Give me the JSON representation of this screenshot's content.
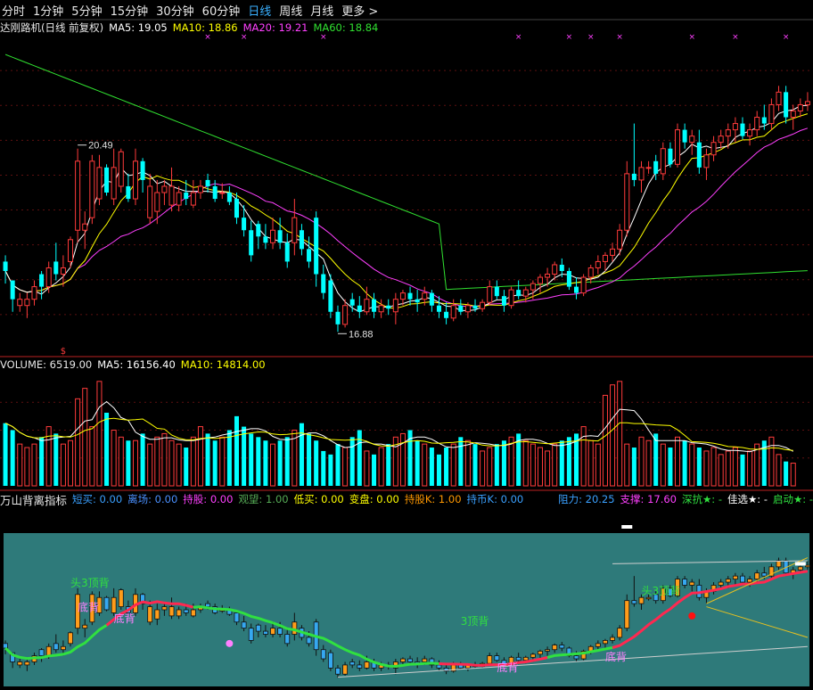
{
  "tabs": {
    "items": [
      "分时",
      "1分钟",
      "5分钟",
      "15分钟",
      "30分钟",
      "60分钟",
      "日线",
      "周线",
      "月线",
      "更多 >"
    ],
    "active_index": 6
  },
  "main_panel": {
    "title": "达刚路机(日线 前复权)",
    "ma5": "MA5: 19.05",
    "ma10": "MA10: 18.86",
    "ma20": "MA20: 19.21",
    "ma60": "MA60: 18.84",
    "high_label": "20.49",
    "low_label": "16.88",
    "signal_mark": "$"
  },
  "volume_panel": {
    "volume": "VOLUME: 6519.00",
    "ma5": "MA5: 16156.40",
    "ma10": "MA10: 14814.00"
  },
  "indicator_panel": {
    "name": "万山背离指标",
    "items": [
      {
        "label": "短买:",
        "value": "0.00",
        "color": "#3aa0ff"
      },
      {
        "label": "离场:",
        "value": "0.00",
        "color": "#4a90ff"
      },
      {
        "label": "持股:",
        "value": "0.00",
        "color": "#ff40ff"
      },
      {
        "label": "观望:",
        "value": "1.00",
        "color": "#55aa55"
      },
      {
        "label": "低买:",
        "value": "0.00",
        "color": "#ffff00"
      },
      {
        "label": "变盘:",
        "value": "0.00",
        "color": "#ffff00"
      },
      {
        "label": "持股K:",
        "value": "1.00",
        "color": "#ff9800"
      },
      {
        "label": "持币K:",
        "value": "0.00",
        "color": "#3aa0ff"
      }
    ],
    "resist": "阻力: 20.25",
    "support": "支撑: 17.60",
    "deep": "深抗★: -",
    "best": "佳选★: -",
    "start": "启动★: -",
    "annotations": [
      {
        "text": "头3顶背",
        "color": "#30e040"
      },
      {
        "text": "底背",
        "color": "#ff80ff"
      },
      {
        "text": "底背",
        "color": "#ff80ff"
      },
      {
        "text": "3顶背",
        "color": "#30e040"
      },
      {
        "text": "头3顶背",
        "color": "#30e040"
      },
      {
        "text": "底背",
        "color": "#ff80ff"
      },
      {
        "text": "底背",
        "color": "#ff80ff"
      }
    ]
  },
  "colors": {
    "up": "#ff3b3b",
    "down": "#00ffff",
    "ma5": "#ffffff",
    "ma10": "#ffff00",
    "ma20": "#ff40ff",
    "ma60": "#30e030",
    "grid_red": "#9b1c1c",
    "indicator_bg": "#2e7a7a"
  },
  "chart_data": {
    "type": "candlestick",
    "price_series": {
      "name": "达刚路机",
      "ylim": [
        16.6,
        21.6
      ],
      "ohlc": [
        [
          18.0,
          18.1,
          17.65,
          17.85
        ],
        [
          17.7,
          17.7,
          17.2,
          17.4
        ],
        [
          17.3,
          17.5,
          17.2,
          17.4
        ],
        [
          17.3,
          17.5,
          17.1,
          17.4
        ],
        [
          17.4,
          17.7,
          17.3,
          17.6
        ],
        [
          17.8,
          17.85,
          17.4,
          17.6
        ],
        [
          17.6,
          18.0,
          17.5,
          17.9
        ],
        [
          18.0,
          18.3,
          17.7,
          17.8
        ],
        [
          17.8,
          18.1,
          17.6,
          17.9
        ],
        [
          18.0,
          18.4,
          17.9,
          18.35
        ],
        [
          18.5,
          19.8,
          18.3,
          19.6
        ],
        [
          18.5,
          18.8,
          18.2,
          18.6
        ],
        [
          18.7,
          19.7,
          18.6,
          19.6
        ],
        [
          19.0,
          19.7,
          18.9,
          19.5
        ],
        [
          19.5,
          19.55,
          19.05,
          19.1
        ],
        [
          19.0,
          19.8,
          18.9,
          19.5
        ],
        [
          19.2,
          19.8,
          19.1,
          19.75
        ],
        [
          19.2,
          19.4,
          18.95,
          19.0
        ],
        [
          19.0,
          19.8,
          18.9,
          19.6
        ],
        [
          19.6,
          19.65,
          19.1,
          19.3
        ],
        [
          18.7,
          19.4,
          18.6,
          19.2
        ],
        [
          18.8,
          19.3,
          18.6,
          19.1
        ],
        [
          19.1,
          19.3,
          18.9,
          19.2
        ],
        [
          18.9,
          19.5,
          18.8,
          19.2
        ],
        [
          18.9,
          19.2,
          18.8,
          19.1
        ],
        [
          19.1,
          19.3,
          18.9,
          19.0
        ],
        [
          18.9,
          19.3,
          18.85,
          19.1
        ],
        [
          19.1,
          19.3,
          19.0,
          19.2
        ],
        [
          19.3,
          19.4,
          19.1,
          19.2
        ],
        [
          19.2,
          19.3,
          18.95,
          19.0
        ],
        [
          19.1,
          19.25,
          19.0,
          19.1
        ],
        [
          19.1,
          19.2,
          18.9,
          18.95
        ],
        [
          19.0,
          19.1,
          18.6,
          18.7
        ],
        [
          18.7,
          18.9,
          18.4,
          18.5
        ],
        [
          18.5,
          18.65,
          18.0,
          18.1
        ],
        [
          18.6,
          18.65,
          18.2,
          18.4
        ],
        [
          18.4,
          18.6,
          18.2,
          18.3
        ],
        [
          18.3,
          18.7,
          18.2,
          18.5
        ],
        [
          18.5,
          18.7,
          18.2,
          18.3
        ],
        [
          18.3,
          18.45,
          17.9,
          18.0
        ],
        [
          18.3,
          19.0,
          18.1,
          18.7
        ],
        [
          18.5,
          18.6,
          18.1,
          18.2
        ],
        [
          18.2,
          18.4,
          17.9,
          18.0
        ],
        [
          18.7,
          18.8,
          17.6,
          17.8
        ],
        [
          17.8,
          17.95,
          17.4,
          17.5
        ],
        [
          17.7,
          17.8,
          17.1,
          17.2
        ],
        [
          17.2,
          17.3,
          16.88,
          17.0
        ],
        [
          17.0,
          17.4,
          16.95,
          17.3
        ],
        [
          17.4,
          17.5,
          17.2,
          17.3
        ],
        [
          17.3,
          17.45,
          17.1,
          17.2
        ],
        [
          17.2,
          17.6,
          17.15,
          17.4
        ],
        [
          17.4,
          17.5,
          17.1,
          17.2
        ],
        [
          17.2,
          17.4,
          17.1,
          17.3
        ],
        [
          17.3,
          17.4,
          17.15,
          17.25
        ],
        [
          17.2,
          17.5,
          17.0,
          17.4
        ],
        [
          17.4,
          17.55,
          17.3,
          17.5
        ],
        [
          17.5,
          17.6,
          17.3,
          17.4
        ],
        [
          17.4,
          17.55,
          17.2,
          17.35
        ],
        [
          17.4,
          17.6,
          17.3,
          17.5
        ],
        [
          17.5,
          17.55,
          17.2,
          17.3
        ],
        [
          17.3,
          17.45,
          17.1,
          17.2
        ],
        [
          17.2,
          17.35,
          17.0,
          17.1
        ],
        [
          17.1,
          17.4,
          17.05,
          17.3
        ],
        [
          17.3,
          17.4,
          17.15,
          17.2
        ],
        [
          17.2,
          17.35,
          17.1,
          17.3
        ],
        [
          17.3,
          17.4,
          17.2,
          17.25
        ],
        [
          17.25,
          17.4,
          17.2,
          17.35
        ],
        [
          17.35,
          17.7,
          17.3,
          17.6
        ],
        [
          17.6,
          17.7,
          17.4,
          17.45
        ],
        [
          17.45,
          17.55,
          17.2,
          17.3
        ],
        [
          17.3,
          17.6,
          17.25,
          17.55
        ],
        [
          17.55,
          17.7,
          17.4,
          17.45
        ],
        [
          17.45,
          17.6,
          17.35,
          17.55
        ],
        [
          17.55,
          17.7,
          17.4,
          17.65
        ],
        [
          17.65,
          17.8,
          17.5,
          17.75
        ],
        [
          17.75,
          17.9,
          17.6,
          17.8
        ],
        [
          17.8,
          18.0,
          17.7,
          17.95
        ],
        [
          17.95,
          18.05,
          17.75,
          17.85
        ],
        [
          17.85,
          17.9,
          17.55,
          17.6
        ],
        [
          17.6,
          17.75,
          17.4,
          17.5
        ],
        [
          17.5,
          17.8,
          17.45,
          17.75
        ],
        [
          17.75,
          17.95,
          17.65,
          17.9
        ],
        [
          17.9,
          18.1,
          17.8,
          18.0
        ],
        [
          18.0,
          18.15,
          17.85,
          18.1
        ],
        [
          18.1,
          18.3,
          18.0,
          18.2
        ],
        [
          18.2,
          18.6,
          18.1,
          18.5
        ],
        [
          18.5,
          19.6,
          18.4,
          19.4
        ],
        [
          19.4,
          20.2,
          19.2,
          19.3
        ],
        [
          19.3,
          19.6,
          19.1,
          19.5
        ],
        [
          19.5,
          19.6,
          19.4,
          19.5
        ],
        [
          19.6,
          19.7,
          19.3,
          19.4
        ],
        [
          19.4,
          19.9,
          19.3,
          19.8
        ],
        [
          19.8,
          19.9,
          19.5,
          19.55
        ],
        [
          19.55,
          20.2,
          19.5,
          20.1
        ],
        [
          20.1,
          20.2,
          19.8,
          19.9
        ],
        [
          19.9,
          20.1,
          19.7,
          20.0
        ],
        [
          19.9,
          20.1,
          19.4,
          19.5
        ],
        [
          19.5,
          19.8,
          19.3,
          19.7
        ],
        [
          19.7,
          20.0,
          19.6,
          19.9
        ],
        [
          19.9,
          20.1,
          19.8,
          20.0
        ],
        [
          20.0,
          20.2,
          19.8,
          20.1
        ],
        [
          20.1,
          20.3,
          19.9,
          20.2
        ],
        [
          20.2,
          20.3,
          19.95,
          20.0
        ],
        [
          20.0,
          20.2,
          19.85,
          20.1
        ],
        [
          20.1,
          20.4,
          20.0,
          20.3
        ],
        [
          20.3,
          20.5,
          20.1,
          20.2
        ],
        [
          20.2,
          20.6,
          20.1,
          20.5
        ],
        [
          20.5,
          20.8,
          20.4,
          20.7
        ],
        [
          20.7,
          20.8,
          20.2,
          20.3
        ],
        [
          20.3,
          20.5,
          20.1,
          20.4
        ],
        [
          20.4,
          20.6,
          20.3,
          20.5
        ],
        [
          20.5,
          20.7,
          20.4,
          20.55
        ]
      ]
    },
    "ma_series": [
      {
        "name": "MA5",
        "color": "#ffffff"
      },
      {
        "name": "MA10",
        "color": "#ffff00"
      },
      {
        "name": "MA20",
        "color": "#ff40ff"
      },
      {
        "name": "MA60",
        "color": "#30e030"
      }
    ],
    "volume_series": {
      "name": "VOLUME",
      "ylim": [
        0,
        32000
      ],
      "values": [
        18000,
        16000,
        12000,
        11000,
        12000,
        14000,
        17000,
        15000,
        12000,
        13000,
        25000,
        28000,
        17000,
        30000,
        21000,
        16000,
        14000,
        13000,
        13000,
        15000,
        12000,
        14000,
        15000,
        13000,
        12000,
        11000,
        14000,
        17000,
        15000,
        13000,
        14000,
        16000,
        20000,
        17000,
        15000,
        14000,
        13000,
        12000,
        13000,
        14000,
        16000,
        18000,
        15000,
        13000,
        10000,
        9000,
        12000,
        11000,
        14000,
        16000,
        10000,
        9000,
        11000,
        12000,
        14000,
        15000,
        16000,
        13000,
        12000,
        11000,
        9000,
        11000,
        12000,
        14000,
        13000,
        12000,
        10000,
        11000,
        12000,
        13000,
        14000,
        15000,
        13000,
        12000,
        11000,
        10000,
        12000,
        13000,
        14000,
        15000,
        17000,
        13000,
        12000,
        26000,
        29000,
        30000,
        12000,
        11000,
        14000,
        13000,
        15000,
        12000,
        11000,
        14000,
        13000,
        12000,
        11000,
        10000,
        11000,
        9000,
        10000,
        11000,
        9000,
        10000,
        12000,
        13000,
        14000,
        9000,
        7000,
        6519
      ],
      "up_flags_from_price": true
    },
    "indicator_series": {
      "name": "万山背离指标",
      "ylim": [
        0,
        100
      ]
    }
  }
}
